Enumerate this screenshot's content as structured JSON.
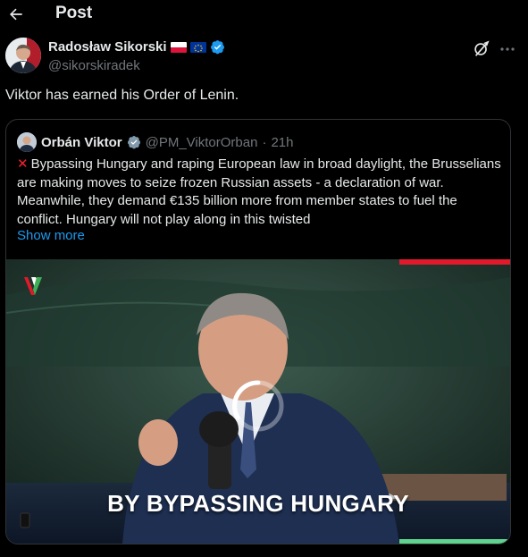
{
  "header": {
    "title": "Post"
  },
  "author": {
    "name": "Radosław Sikorski",
    "handle": "@sikorskiradek"
  },
  "post": {
    "text": "Viktor has earned his Order of Lenin."
  },
  "quote": {
    "name": "Orbán Viktor",
    "handle": "@PM_ViktorOrban",
    "separator": "·",
    "time": "21h",
    "text": "Bypassing Hungary and raping European law in broad daylight, the Brusselians are making moves to seize frozen Russian assets - a declaration of war. Meanwhile, they demand €135 billion more from member states to fuel the conflict. Hungary will not play along in this twisted",
    "show_more": "Show more",
    "video_caption": "BY BYPASSING HUNGARY"
  },
  "colors": {
    "background": "#000000",
    "accent": "#1d9bf0",
    "verified": "#1d9bf0",
    "muted": "#71767b",
    "cross": "#f4212e"
  },
  "icons": [
    "back-arrow-icon",
    "verified-badge-icon",
    "grok-icon",
    "more-icon",
    "red-cross-icon",
    "loading-spinner-icon",
    "channel-logo-icon"
  ]
}
